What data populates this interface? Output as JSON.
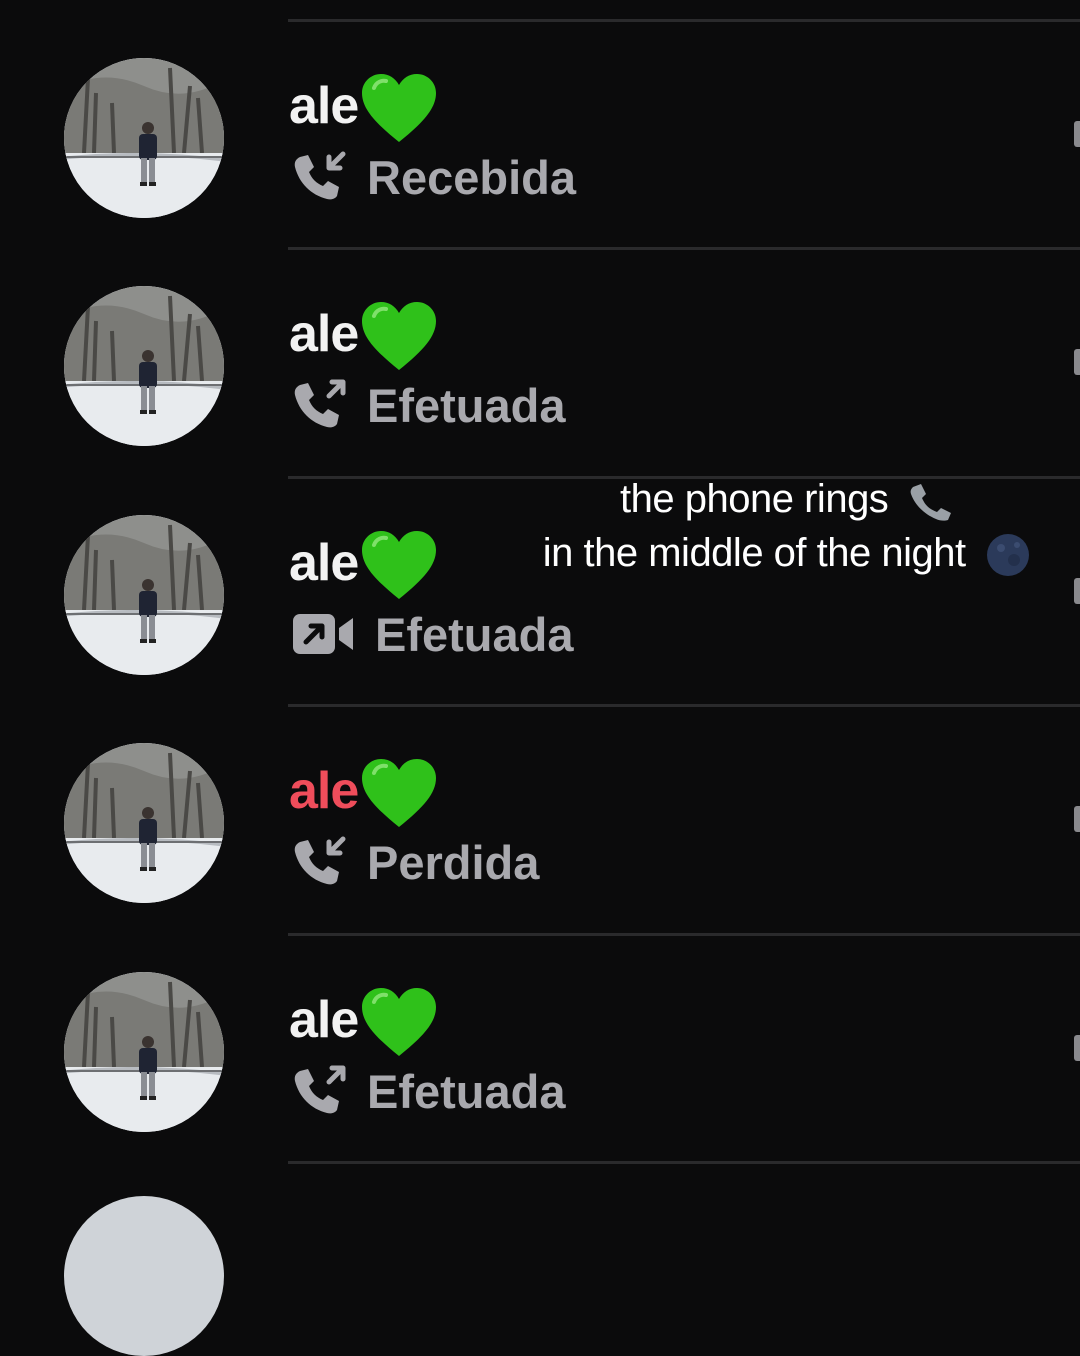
{
  "calls": [
    {
      "name": "ale",
      "type_label": "Recebida",
      "direction": "incoming",
      "kind": "voice",
      "missed": false
    },
    {
      "name": "ale",
      "type_label": "Efetuada",
      "direction": "outgoing",
      "kind": "voice",
      "missed": false
    },
    {
      "name": "ale",
      "type_label": "Efetuada",
      "direction": "outgoing",
      "kind": "video",
      "missed": false
    },
    {
      "name": "ale",
      "type_label": "Perdida",
      "direction": "incoming",
      "kind": "voice",
      "missed": true
    },
    {
      "name": "ale",
      "type_label": "Efetuada",
      "direction": "outgoing",
      "kind": "voice",
      "missed": false
    }
  ],
  "overlay_caption": {
    "line1": "the phone rings",
    "line2": "in the middle of the night",
    "line1_emoji": "telephone-receiver-icon",
    "line2_emoji": "new-moon-icon"
  },
  "colors": {
    "background": "#0b0b0c",
    "name": "#f2f2f2",
    "missed_name": "#ef4d5b",
    "secondary": "#a9a9ae",
    "heart": "#2fc11a",
    "divider": "#2a2a2c"
  },
  "icons": {
    "name_suffix": "green-heart-icon",
    "incoming_voice": "phone-incoming-icon",
    "outgoing_voice": "phone-outgoing-icon",
    "outgoing_video": "video-outgoing-icon"
  }
}
